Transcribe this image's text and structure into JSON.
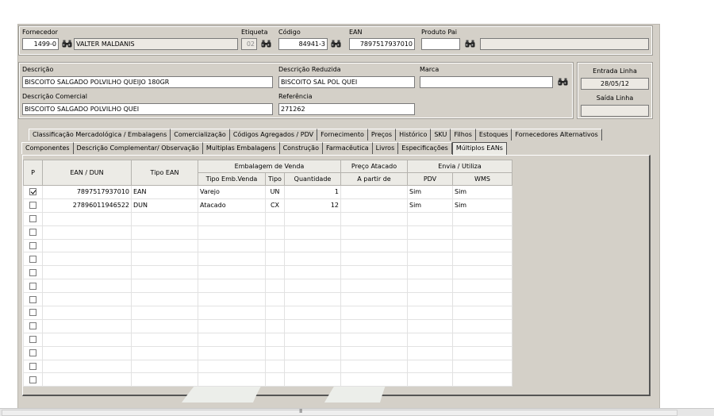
{
  "header": {
    "fornecedor_label": "Fornecedor",
    "fornecedor_code": "1499-0",
    "fornecedor_name": "VALTER MALDANIS",
    "etiqueta_label": "Etiqueta",
    "etiqueta_value": "02",
    "codigo_label": "Código",
    "codigo_value": "84941-3",
    "ean_label": "EAN",
    "ean_value": "7897517937010",
    "produto_pai_label": "Produto Pai",
    "produto_pai_code": "",
    "produto_pai_name": ""
  },
  "descricao": {
    "descricao_label": "Descrição",
    "descricao_value": "BISCOITO SALGADO POLVILHO QUEIJO 180GR",
    "descricao_reduzida_label": "Descrição Reduzida",
    "descricao_reduzida_value": "BISCOITO SAL POL QUEI",
    "marca_label": "Marca",
    "marca_value": "",
    "descricao_comercial_label": "Descrição Comercial",
    "descricao_comercial_value": "BISCOITO SALGADO POLVILHO QUEI",
    "referencia_label": "Referência",
    "referencia_value": "271262"
  },
  "linha": {
    "entrada_label": "Entrada Linha",
    "entrada_value": "28/05/12",
    "saida_label": "Saída Linha",
    "saida_value": ""
  },
  "tabs_row1": [
    "Classificação Mercadológica / Embalagens",
    "Comercialização",
    "Códigos Agregados / PDV",
    "Fornecimento",
    "Preços",
    "Histórico",
    "SKU",
    "Filhos",
    "Estoques",
    "Fornecedores Alternativos"
  ],
  "tabs_row2": [
    "Componentes",
    "Descrição Complementar/ Observação",
    "Multiplas Embalagens",
    "Construção",
    "Farmacêutica",
    "Livros",
    "Especificações",
    "Múltiplos EANs"
  ],
  "active_tab": "Múltiplos EANs",
  "grid": {
    "headers": {
      "p": "P",
      "ean_dun": "EAN / DUN",
      "tipo_ean": "Tipo EAN",
      "embalagem_group": "Embalagem de Venda",
      "tipo_emb_venda": "Tipo Emb.Venda",
      "tipo": "Tipo",
      "quantidade": "Quantidade",
      "preco_group": "Preço Atacado",
      "a_partir_de": "A partir de",
      "envia_group": "Envia / Utiliza",
      "pdv": "PDV",
      "wms": "WMS"
    },
    "rows": [
      {
        "checked": true,
        "ean": "7897517937010",
        "tipo_ean": "EAN",
        "tipo_emb": "Varejo",
        "tipo": "UN",
        "qtd": "1",
        "preco": "",
        "pdv": "Sim",
        "wms": "Sim"
      },
      {
        "checked": false,
        "ean": "27896011946522",
        "tipo_ean": "DUN",
        "tipo_emb": "Atacado",
        "tipo": "CX",
        "qtd": "12",
        "preco": "",
        "pdv": "Sim",
        "wms": "Sim"
      }
    ],
    "empty_rows": 13
  },
  "scrollbar": {
    "grip": "III"
  }
}
